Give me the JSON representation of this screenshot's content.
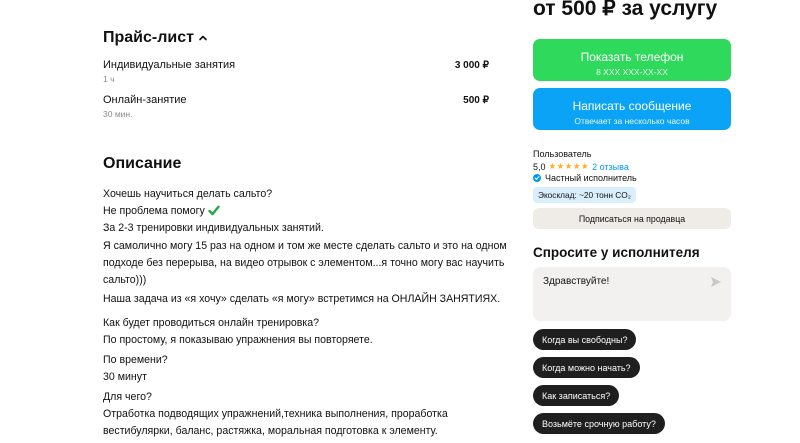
{
  "price_list": {
    "title": "Прайс-лист",
    "items": [
      {
        "name": "Индивидуальные занятия",
        "duration": "1 ч",
        "price": "3 000 ₽"
      },
      {
        "name": "Онлайн-занятие",
        "duration": "30 мин.",
        "price": "500 ₽"
      }
    ]
  },
  "description": {
    "title": "Описание",
    "paragraphs": [
      [
        "Хочешь научиться делать сальто?",
        "Не проблема помогу",
        "За 2-3 тренировки индивидуальных занятий."
      ],
      [
        "Я самолично могу 15 раз на одном и том же месте сделать сальто и это на одном",
        "подходе без перерыва, на видео отрывок с элементом...я точно могу вас научить",
        "сальто)))"
      ],
      [
        "Наша задача из «я хочу» сделать «я могу» встретимся на ОНЛАЙН ЗАНЯТИЯХ."
      ],
      [
        "Как будет проводиться онлайн тренировка?",
        "По простому, я показываю упражнения вы повторяете."
      ],
      [
        "По времени?",
        "30 минут"
      ],
      [
        "Для чего?",
        "Отработка подводящих упражнений,техника выполнения, проработка",
        "вестибулярки, баланс, растяжка, моральная подготовка к элементу."
      ]
    ]
  },
  "sidebar": {
    "price_heading": "от 500 ₽ за услугу",
    "show_phone": {
      "label": "Показать телефон",
      "sub": "8 XXX XXX-XX-XX"
    },
    "write_message": {
      "label": "Написать сообщение",
      "sub": "Отвечает за несколько часов"
    },
    "seller": {
      "name": "Пользователь",
      "rating": "5,0",
      "stars": "★★★★★",
      "reviews": "2 отзыва",
      "type": "Частный исполнитель",
      "eco_badge": "Экосклад: ~20 тонн CO₂"
    },
    "subscribe_label": "Подписаться на продавца",
    "ask": {
      "title": "Спросите у исполнителя",
      "message_value": "Здравствуйте!",
      "chips": [
        "Когда вы свободны?",
        "Когда можно начать?",
        "Как записаться?",
        "Возьмёте срочную работу?"
      ]
    }
  },
  "colors": {
    "green_button": "#2ed95c",
    "blue_button": "#0aa3f5",
    "star": "#ffb021",
    "link": "#0099f7",
    "check": "#27a844"
  }
}
